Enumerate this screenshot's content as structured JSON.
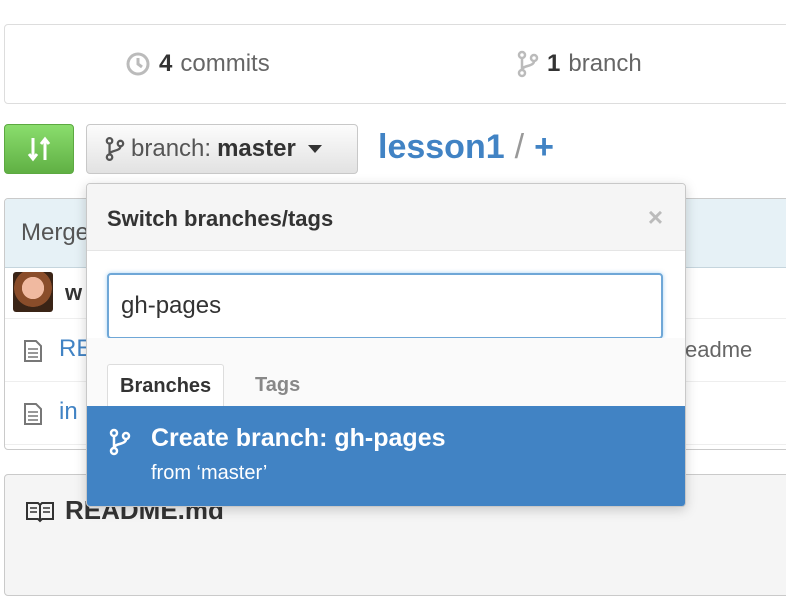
{
  "summary": {
    "commits_count": "4",
    "commits_label": "commits",
    "branch_count": "1",
    "branch_label": "branch"
  },
  "branch_selector": {
    "prefix": "branch:",
    "current": "master"
  },
  "breadcrumb": {
    "repo": "lesson1",
    "separator": "/",
    "add": "+"
  },
  "file_list": {
    "commit_message_partial": "Merge",
    "author_partial": "w",
    "files": [
      {
        "name_partial": "RE",
        "message_partial": "eadme"
      },
      {
        "name_partial": "in",
        "message_partial": ""
      }
    ]
  },
  "readme": {
    "title": "README.md"
  },
  "dropdown": {
    "title": "Switch branches/tags",
    "close": "×",
    "filter_value": "gh-pages",
    "tabs": [
      {
        "label": "Branches",
        "active": true
      },
      {
        "label": "Tags",
        "active": false
      }
    ],
    "create_title": "Create branch: gh-pages",
    "create_sub": "from ‘master’"
  },
  "colors": {
    "link": "#4183c4",
    "compare_green": "#60b044",
    "highlight": "#4183c4"
  }
}
